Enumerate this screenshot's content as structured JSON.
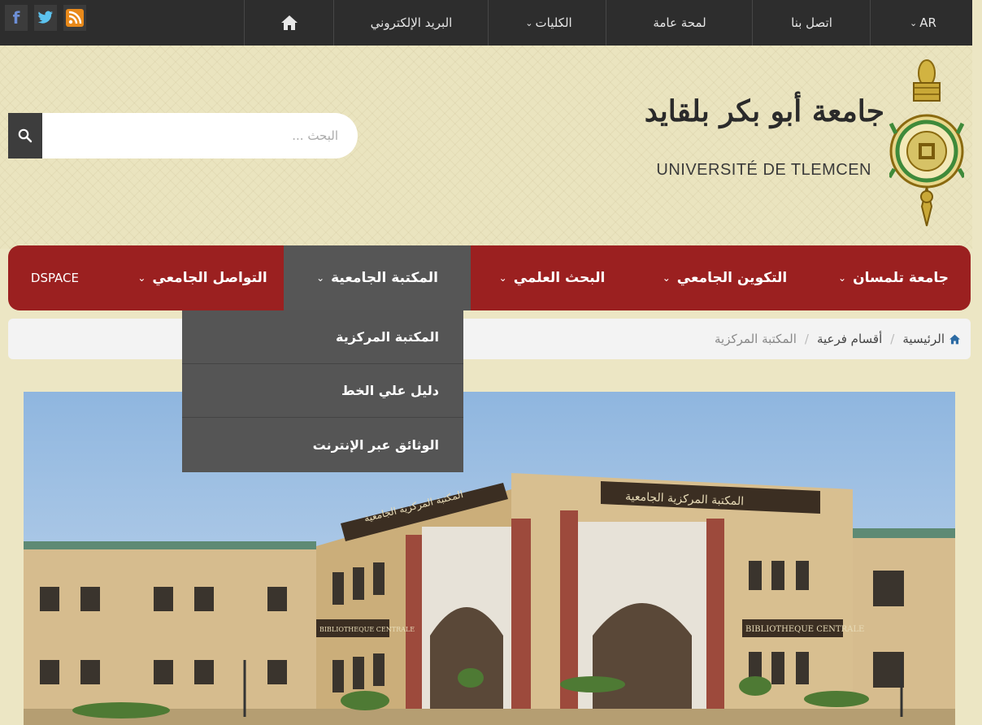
{
  "topbar": {
    "social": [
      "facebook-icon",
      "twitter-icon",
      "rss-icon"
    ],
    "home_icon": "home-icon",
    "email_label": "البريد الإلكتروني",
    "faculties_label": "الكليات",
    "overview_label": "لمحة عامة",
    "contact_label": "اتصل بنا",
    "language_label": "AR"
  },
  "search": {
    "placeholder": "البحث ...",
    "icon": "search-icon"
  },
  "logo": {
    "arabic_name": "جامعة أبو بكر بلقايد",
    "french_name": "UNIVERSITÉ DE TLEMCEN"
  },
  "mainnav": {
    "items": [
      {
        "label": "جامعة تلمسان"
      },
      {
        "label": "التكوين الجامعي"
      },
      {
        "label": "البحث العلمي"
      },
      {
        "label": "المكتبة الجامعية"
      },
      {
        "label": "التواصل الجامعي"
      },
      {
        "label": "DSPACE"
      }
    ],
    "active_index": 3
  },
  "dropdown": {
    "items": [
      {
        "label": "المكتبة المركزية"
      },
      {
        "label": "دليل علي الخط"
      },
      {
        "label": "الوثائق عبر الإنترنت"
      }
    ]
  },
  "breadcrumb": {
    "items": [
      "الرئيسية",
      "أقسام فرعية",
      "المكتبة المركزية"
    ]
  },
  "photo": {
    "sign_top": "المكتبة المركزية الجامعية",
    "sign_plaque": "BIBLIOTHEQUE CENTRALE"
  },
  "colors": {
    "nav_red": "#9b2020",
    "topbar": "#2d2d2d",
    "active_tab": "#565656"
  }
}
